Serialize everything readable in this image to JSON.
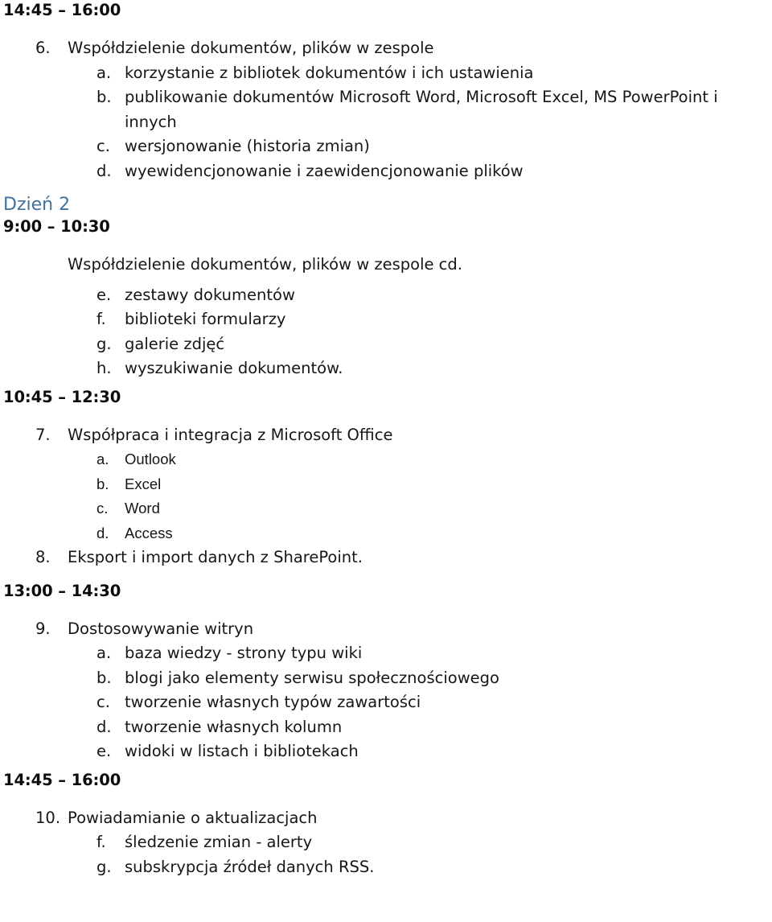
{
  "document": {
    "language": "pl",
    "background_color": "#ffffff",
    "text_color": "#161616",
    "day_label_color": "#41719C"
  },
  "blocks": {
    "time_1445_top": "14:45 – 16:00",
    "day2_label": "Dzień 2",
    "time_0900": "9:00 – 10:30",
    "time_1045": "10:45 – 12:30",
    "time_1300": "13:00 – 14:30",
    "time_1445_bottom": "14:45 – 16:00"
  },
  "section_1": {
    "item6": {
      "marker": "6.",
      "text": "Współdzielenie dokumentów, plików w zespole"
    },
    "sub": [
      {
        "marker": "a.",
        "text": "korzystanie z bibliotek dokumentów i ich ustawienia"
      },
      {
        "marker": "b.",
        "text": "publikowanie dokumentów Microsoft Word, Microsoft Excel, MS PowerPoint i innych"
      },
      {
        "marker": "c.",
        "text": "wersjonowanie (historia zmian)"
      },
      {
        "marker": "d.",
        "text": "wyewidencjonowanie i zaewidencjonowanie plików"
      }
    ],
    "sub_b_continuation": "plików"
  },
  "section_2": {
    "intro": "Współdzielenie dokumentów, plików w zespole cd.",
    "sub": [
      {
        "marker": "e.",
        "text": "zestawy dokumentów"
      },
      {
        "marker": "f.",
        "text": "biblioteki formularzy"
      },
      {
        "marker": "g.",
        "text": "galerie zdjęć"
      },
      {
        "marker": "h.",
        "text": "wyszukiwanie dokumentów."
      }
    ]
  },
  "section_3": {
    "item7": {
      "marker": "7.",
      "text": "Współpraca i integracja z Microsoft Office"
    },
    "sub": [
      {
        "marker": "a.",
        "text": "Outlook"
      },
      {
        "marker": "b.",
        "text": "Excel"
      },
      {
        "marker": "c.",
        "text": "Word"
      },
      {
        "marker": "d.",
        "text": "Access"
      }
    ],
    "item8": {
      "marker": "8.",
      "text": "Eksport i import danych z SharePoint."
    }
  },
  "section_4": {
    "item9": {
      "marker": "9.",
      "text": "Dostosowywanie witryn"
    },
    "sub": [
      {
        "marker": "a.",
        "text": "baza wiedzy - strony typu wiki"
      },
      {
        "marker": "b.",
        "text": "blogi jako elementy serwisu społecznościowego"
      },
      {
        "marker": "c.",
        "text": "tworzenie własnych typów zawartości"
      },
      {
        "marker": "d.",
        "text": "tworzenie własnych kolumn"
      },
      {
        "marker": "e.",
        "text": "widoki w listach i bibliotekach"
      }
    ]
  },
  "section_5": {
    "item10": {
      "marker": "10.",
      "text": "Powiadamianie o aktualizacjach"
    },
    "sub": [
      {
        "marker": "f.",
        "text": "śledzenie zmian - alerty"
      },
      {
        "marker": "g.",
        "text": "subskrypcja źródeł danych RSS."
      }
    ]
  }
}
